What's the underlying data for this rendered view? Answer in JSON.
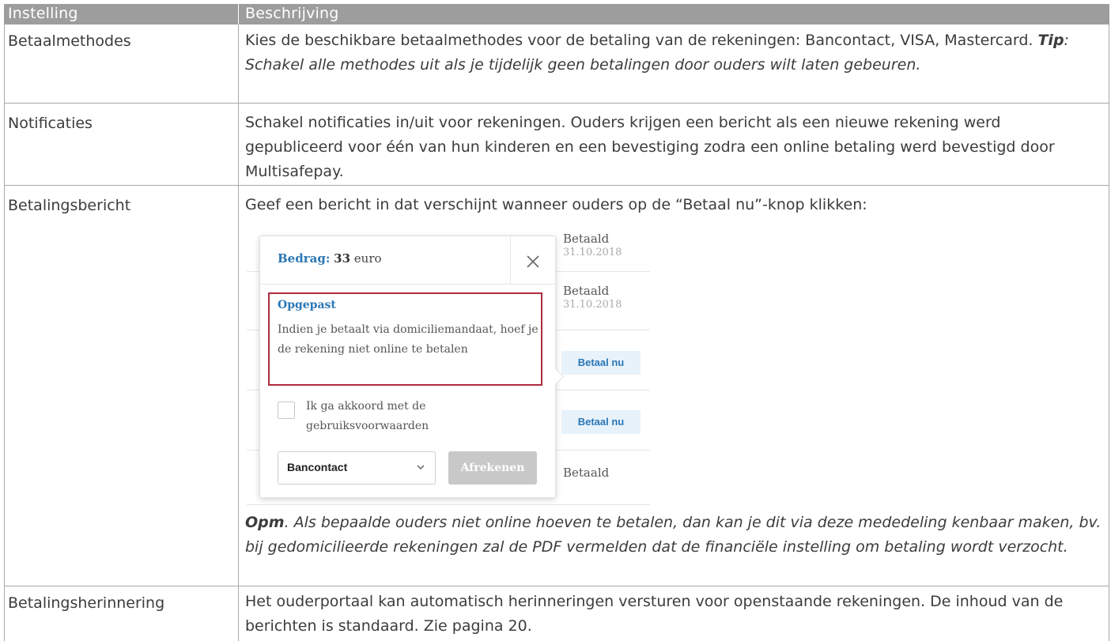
{
  "header": {
    "col1": "Instelling",
    "col2": "Beschrijving"
  },
  "rows": [
    {
      "label": "Betaalmethodes",
      "text_a": "Kies de beschikbare betaalmethodes voor de betaling van de rekeningen: Bancontact, VISA, Mastercard. ",
      "tip_label": "Tip",
      "tip_text": ": Schakel alle methodes uit als je tijdelijk geen betalingen door ouders wilt laten gebeuren."
    },
    {
      "label": "Notificaties",
      "text": "Schakel notificaties in/uit voor rekeningen. Ouders krijgen een bericht als een nieuwe rekening werd gepubliceerd voor één van hun kinderen en een bevestiging zodra een online betaling werd bevestigd door Multisafepay."
    },
    {
      "label": "Betalingsbericht",
      "text": "Geef een bericht in dat verschijnt wanneer ouders op de “Betaal nu”-knop klikken:",
      "opm_label": "Opm",
      "opm_text": ". Als bepaalde ouders niet online hoeven te betalen, dan kan je dit via deze mededeling kenbaar maken, bv. bij gedomicilieerde rekeningen zal de PDF vermelden dat de financiële instelling om betaling wordt verzocht."
    },
    {
      "label": "Betalingsherinnering",
      "text": "Het ouderportaal kan automatisch herinneringen versturen voor openstaande rekeningen. De inhoud van de berichten is standaard. Zie pagina 20."
    }
  ],
  "screenshot": {
    "statuses": [
      {
        "status": "Betaald",
        "date": "31.10.2018"
      },
      {
        "status": "Betaald",
        "date": "31.10.2018"
      },
      {
        "button": "Betaal nu"
      },
      {
        "button": "Betaal nu"
      },
      {
        "status": "Betaald"
      }
    ],
    "popup": {
      "amount_key": "Bedrag:",
      "amount_value": "33",
      "amount_unit": "euro",
      "close_icon": "close-icon",
      "warning_title": "Opgepast",
      "warning_text": "Indien je betaalt via domiciliemandaat, hoef je de rekening niet online te betalen",
      "checkbox_label": "Ik ga akkoord met de gebruiksvoorwaarden",
      "select_value": "Bancontact",
      "chevron_icon": "chevron-down-icon",
      "submit_label": "Afrekenen"
    },
    "colors": {
      "accent": "#2a77b5",
      "warning_border": "#b02a3e",
      "header_bg": "#9d9d9d"
    }
  }
}
